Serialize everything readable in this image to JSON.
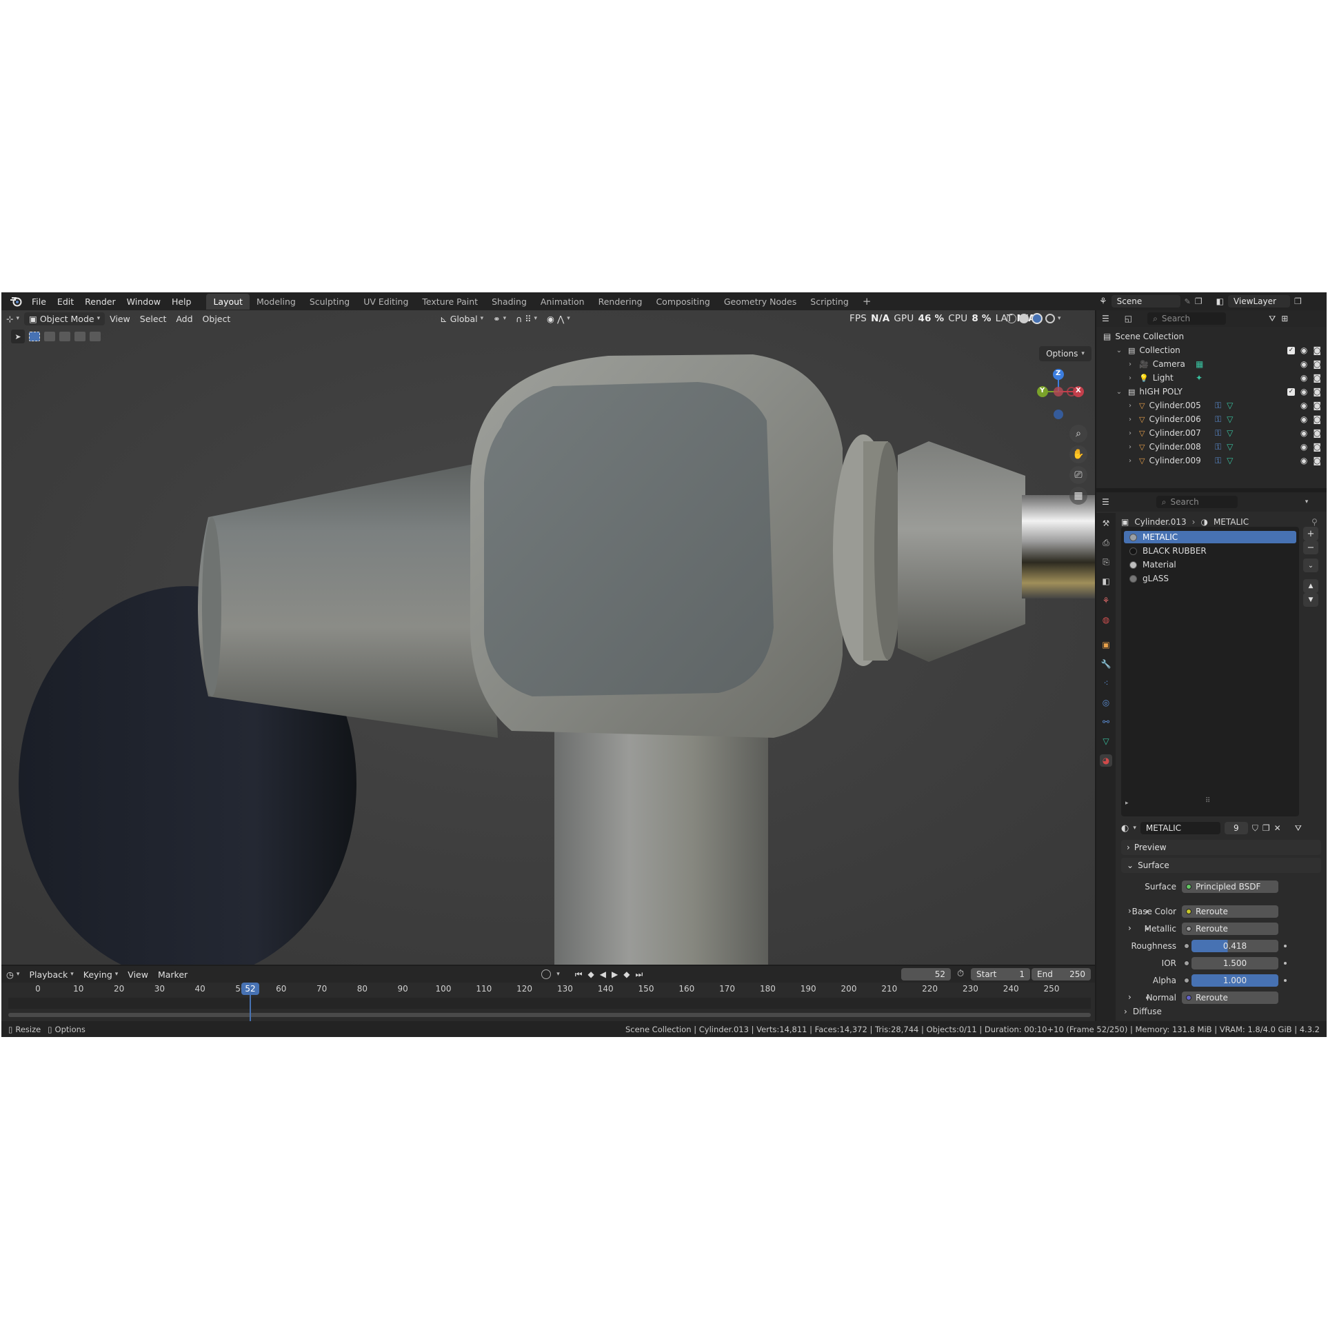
{
  "menu": [
    "File",
    "Edit",
    "Render",
    "Window",
    "Help"
  ],
  "workspaces": [
    {
      "label": "Layout",
      "active": true
    },
    {
      "label": "Modeling"
    },
    {
      "label": "Sculpting"
    },
    {
      "label": "UV Editing"
    },
    {
      "label": "Texture Paint"
    },
    {
      "label": "Shading"
    },
    {
      "label": "Animation"
    },
    {
      "label": "Rendering"
    },
    {
      "label": "Compositing"
    },
    {
      "label": "Geometry Nodes"
    },
    {
      "label": "Scripting"
    }
  ],
  "add_workspace": "+",
  "scene": {
    "name": "Scene",
    "view_layer": "ViewLayer"
  },
  "viewport": {
    "mode": "Object Mode",
    "menus": [
      "View",
      "Select",
      "Add",
      "Object"
    ],
    "orientation": "Global",
    "options_label": "Options",
    "stats": {
      "fps_label": "FPS",
      "fps": "N/A",
      "gpu_label": "GPU",
      "gpu": "46 %",
      "cpu_label": "CPU",
      "cpu": "8 %",
      "lat_label": "LAT",
      "lat": "N/A"
    },
    "gizmo": {
      "x": "X",
      "y": "Y",
      "z": "Z"
    }
  },
  "outliner": {
    "search_placeholder": "Search",
    "root": "Scene Collection",
    "rows": [
      {
        "label": "Collection",
        "type": "collection"
      },
      {
        "label": "Camera",
        "type": "camera"
      },
      {
        "label": "Light",
        "type": "light"
      },
      {
        "label": "hIGH POLY",
        "type": "collection"
      },
      {
        "label": "Cylinder.005",
        "type": "mesh"
      },
      {
        "label": "Cylinder.006",
        "type": "mesh"
      },
      {
        "label": "Cylinder.007",
        "type": "mesh"
      },
      {
        "label": "Cylinder.008",
        "type": "mesh"
      },
      {
        "label": "Cylinder.009",
        "type": "mesh"
      }
    ]
  },
  "properties": {
    "search_placeholder": "Search",
    "breadcrumb_object": "Cylinder.013",
    "breadcrumb_material": "METALIC",
    "slots": [
      {
        "label": "METALIC",
        "color": "#9aa0a6",
        "selected": true
      },
      {
        "label": "BLACK RUBBER",
        "color": "#151515"
      },
      {
        "label": "Material",
        "color": "#bdbdbd"
      },
      {
        "label": "gLASS",
        "color": "#777777"
      }
    ],
    "material_name": "METALIC",
    "user_count": "9",
    "preview_label": "Preview",
    "surface_label": "Surface",
    "diffuse_label": "Diffuse",
    "fields": [
      {
        "label": "Surface",
        "value": "Principled BSDF",
        "socket": "#63c763"
      },
      {
        "label": "Base Color",
        "value": "Reroute",
        "socket": "#c7c729"
      },
      {
        "label": "Metallic",
        "value": "Reroute",
        "socket": "#a1a1a1"
      },
      {
        "label": "Roughness",
        "value": "0.418",
        "fill": 0.418
      },
      {
        "label": "IOR",
        "value": "1.500"
      },
      {
        "label": "Alpha",
        "value": "1.000",
        "fill": 1.0
      },
      {
        "label": "Normal",
        "value": "Reroute",
        "socket": "#6363c7"
      }
    ]
  },
  "timeline": {
    "menus": [
      "Playback",
      "Keying",
      "View",
      "Marker"
    ],
    "current_frame": "52",
    "start_label": "Start",
    "start": "1",
    "end_label": "End",
    "end": "250",
    "ruler": [
      "0",
      "10",
      "20",
      "30",
      "40",
      "50",
      "60",
      "70",
      "80",
      "90",
      "100",
      "110",
      "120",
      "130",
      "140",
      "150",
      "160",
      "170",
      "180",
      "190",
      "200",
      "210",
      "220",
      "230",
      "240",
      "250"
    ]
  },
  "statusbar": {
    "left": [
      "Resize",
      "Options"
    ],
    "info": "Scene Collection | Cylinder.013 | Verts:14,811 | Faces:14,372 | Tris:28,744 | Objects:0/11 | Duration: 00:10+10 (Frame 52/250) | Memory: 131.8 MiB | VRAM: 1.8/4.0 GiB | 4.3.2"
  },
  "colors": {
    "accent": "#4772b3",
    "mesh": "#e8a04a",
    "data": "#39c2a0"
  }
}
